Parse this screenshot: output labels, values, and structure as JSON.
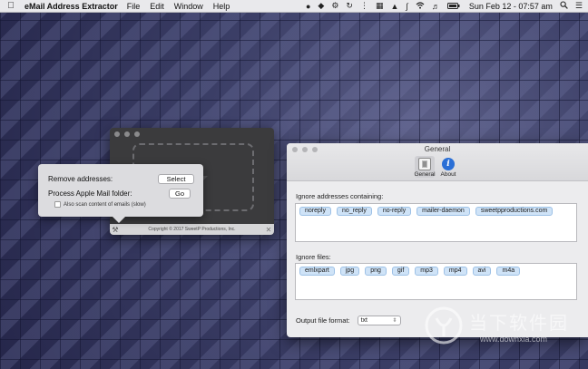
{
  "menubar": {
    "app_name": "eMail Address Extractor",
    "menus": [
      "File",
      "Edit",
      "Window",
      "Help"
    ],
    "clock": "Sun Feb 12 - 07:57 am"
  },
  "about_window": {
    "copyright": "Copyright © 2017 SweetP Productions, Inc."
  },
  "popover": {
    "remove_label": "Remove addresses:",
    "remove_button": "Select",
    "process_label": "Process Apple Mail folder:",
    "process_button": "Go",
    "scan_label": "Also scan content of emails (slow)"
  },
  "prefs": {
    "title": "General",
    "tabs": [
      {
        "label": "General",
        "icon": "general-icon"
      },
      {
        "label": "About",
        "icon": "info-icon"
      }
    ],
    "ignore_addresses_label": "Ignore addresses containing:",
    "ignore_addresses": [
      "noreply",
      "no_reply",
      "no-reply",
      "mailer-daemon",
      "sweetpproductions.com"
    ],
    "ignore_files_label": "Ignore files:",
    "ignore_files": [
      "emlxpart",
      "jpg",
      "png",
      "gif",
      "mp3",
      "mp4",
      "avi",
      "m4a"
    ],
    "output_format_label": "Output file format:",
    "output_format_value": "txt"
  },
  "watermark": {
    "text": "当下软件园",
    "url": "www.downxia.com"
  },
  "colors": {
    "desktop": "#3a3d63",
    "token_fill": "#cfe3f7",
    "token_border": "#9dc1e6",
    "about_icon": "#2a6fd6"
  }
}
